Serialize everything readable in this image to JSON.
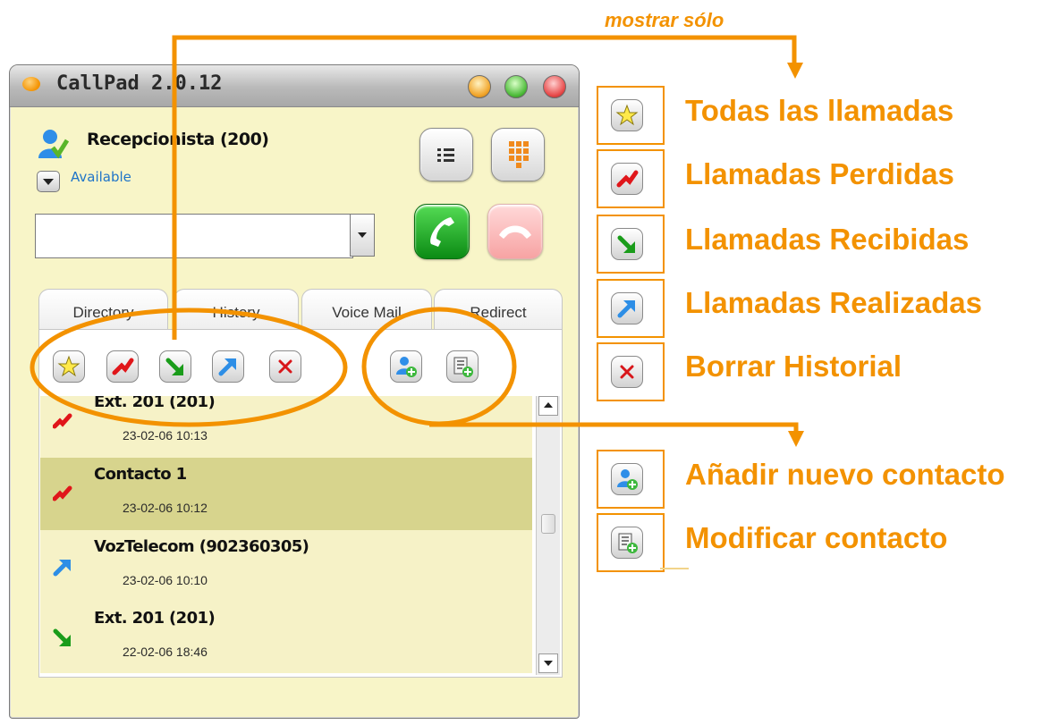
{
  "annotation": {
    "title": "mostrar sólo",
    "accent_color": "#f39200"
  },
  "window": {
    "title": "CallPad 2.0.12",
    "user_name": "Recepcionista (200)",
    "status": "Available",
    "dial_input_value": "",
    "tabs": [
      {
        "label": "Directory"
      },
      {
        "label": "History"
      },
      {
        "label": "Voice Mail"
      },
      {
        "label": "Redirect"
      }
    ],
    "toolbar": {
      "filter_buttons": [
        {
          "icon": "star-icon"
        },
        {
          "icon": "missed-call-icon"
        },
        {
          "icon": "received-call-icon"
        },
        {
          "icon": "outgoing-call-icon"
        },
        {
          "icon": "delete-icon"
        }
      ],
      "contact_buttons": [
        {
          "icon": "add-contact-icon"
        },
        {
          "icon": "edit-contact-icon"
        }
      ]
    },
    "history": [
      {
        "name": "Ext. 201 (201)",
        "date": "23-02-06 10:13",
        "type": "missed"
      },
      {
        "name": "Contacto 1",
        "date": "23-02-06 10:12",
        "type": "missed"
      },
      {
        "name": "VozTelecom (902360305)",
        "date": "23-02-06 10:10",
        "type": "outgoing"
      },
      {
        "name": "Ext. 201 (201)",
        "date": "22-02-06 18:46",
        "type": "received"
      }
    ]
  },
  "legend": {
    "filters": [
      {
        "icon": "star-icon",
        "label": "Todas las llamadas"
      },
      {
        "icon": "missed-call-icon",
        "label": "Llamadas Perdidas"
      },
      {
        "icon": "received-call-icon",
        "label": "Llamadas Recibidas"
      },
      {
        "icon": "outgoing-call-icon",
        "label": "Llamadas Realizadas"
      },
      {
        "icon": "delete-icon",
        "label": "Borrar Historial"
      }
    ],
    "contacts": [
      {
        "icon": "add-contact-icon",
        "label": "Añadir nuevo contacto"
      },
      {
        "icon": "edit-contact-icon",
        "label": "Modificar contacto"
      }
    ]
  }
}
